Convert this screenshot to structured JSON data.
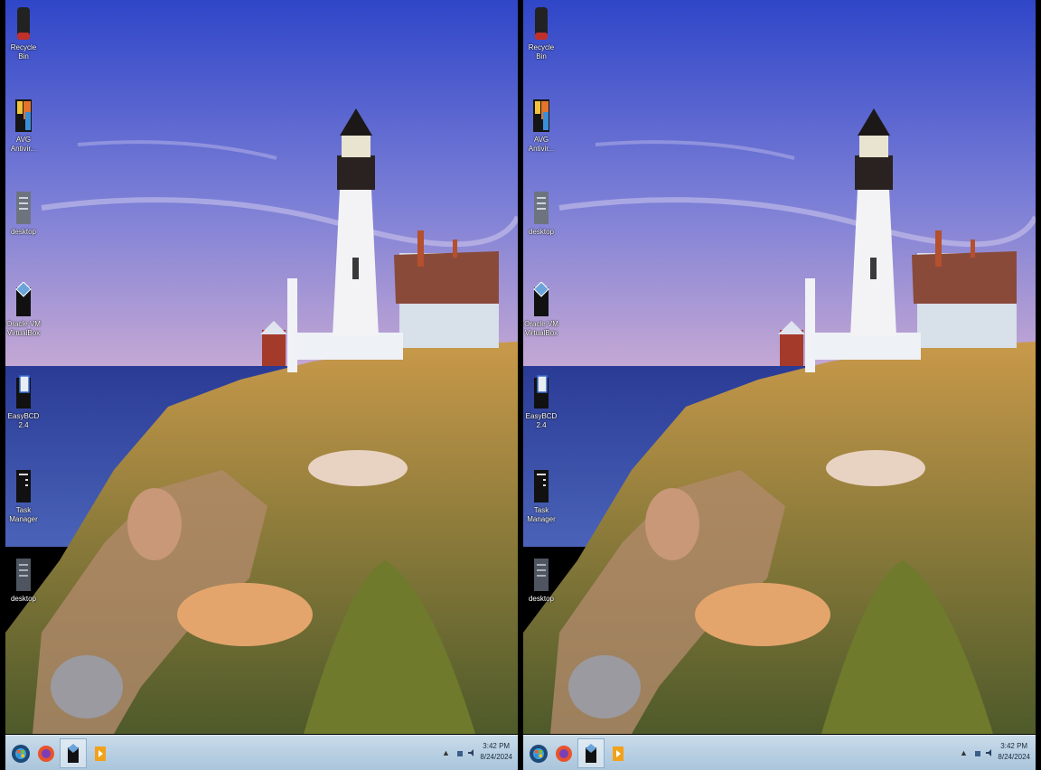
{
  "screens": [
    {
      "id": "left"
    },
    {
      "id": "right"
    }
  ],
  "desktop_icons": [
    {
      "name": "recycle-bin",
      "label": "Recycle Bin",
      "icon": "trash-bin-icon"
    },
    {
      "name": "avg-antivirus",
      "label": "AVG\nAntivir...",
      "icon": "avg-icon"
    },
    {
      "name": "desktop-shortcut-1",
      "label": "desktop",
      "icon": "document-icon"
    },
    {
      "name": "virtualbox",
      "label": "Oracle VM\nVirtualBox",
      "icon": "virtualbox-icon"
    },
    {
      "name": "easybcd",
      "label": "EasyBCD 2.4",
      "icon": "easybcd-icon"
    },
    {
      "name": "task-manager",
      "label": "Task\nManager",
      "icon": "task-manager-icon"
    },
    {
      "name": "desktop-shortcut-2",
      "label": "desktop",
      "icon": "document-icon"
    }
  ],
  "taskbar": {
    "pinned": [
      {
        "name": "start",
        "icon": "windows-orb-icon"
      },
      {
        "name": "firefox",
        "icon": "firefox-icon"
      },
      {
        "name": "virtualbox",
        "icon": "virtualbox-icon",
        "active": true
      },
      {
        "name": "media-player",
        "icon": "media-player-icon"
      }
    ],
    "clock_time": "3:42 PM",
    "clock_date": "8/24/2024"
  },
  "colors": {
    "sky_top": "#3548c9",
    "sky_bottom": "#b8a3d6",
    "sea": "#2c3f9e",
    "grass": "#b0893d",
    "taskbar": "#b8cfe3"
  }
}
